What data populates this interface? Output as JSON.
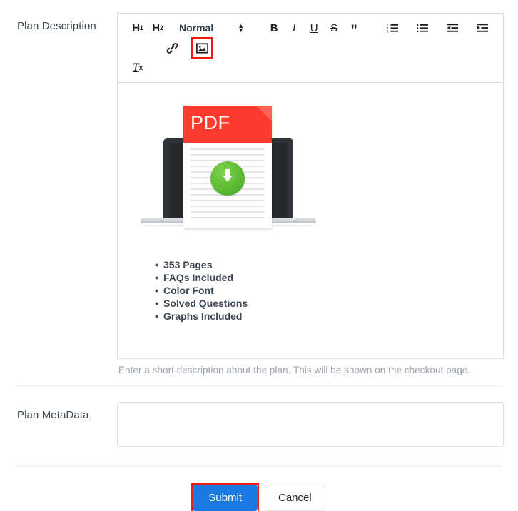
{
  "form": {
    "description_row": {
      "label": "Plan Description",
      "help_text": "Enter a short description about the plan. This will be shown on the checkout page."
    },
    "metadata_row": {
      "label": "Plan MetaData",
      "value": "",
      "placeholder": ""
    }
  },
  "editor": {
    "toolbar": {
      "heading1": "H",
      "heading1_sub": "1",
      "heading2": "H",
      "heading2_sub": "2",
      "format_select_value": "Normal",
      "bold": "B",
      "italic": "I",
      "underline": "U",
      "strike": "S",
      "blockquote": "”",
      "clear_format": "T",
      "clear_format_sub": "x",
      "icons": {
        "ordered_list": "ordered-list-icon",
        "bullet_list": "bullet-list-icon",
        "outdent": "outdent-icon",
        "indent": "indent-icon",
        "link": "link-icon",
        "image": "image-icon"
      },
      "highlighted_button": "image-icon",
      "highlight_color": "#f01a13"
    },
    "content": {
      "illustration": {
        "pdf_label": "PDF",
        "pdf_red": "#fc3a2d",
        "download_green": "#5cbb33",
        "laptop_dark": "#2f3337"
      },
      "features": [
        "353 Pages",
        "FAQs Included",
        "Color Font",
        "Solved Questions",
        "Graphs Included"
      ]
    }
  },
  "footer": {
    "submit_label": "Submit",
    "cancel_label": "Cancel",
    "submit_color": "#1b7ae4",
    "submit_highlight_color": "#f01a13"
  }
}
